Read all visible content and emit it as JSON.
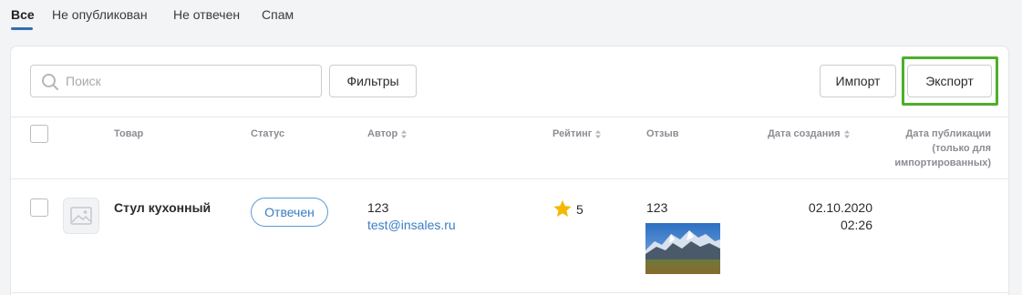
{
  "tabs": [
    {
      "label": "Все",
      "active": true
    },
    {
      "label": "Не опубликован",
      "active": false
    },
    {
      "label": "Не отвечен",
      "active": false
    },
    {
      "label": "Спам",
      "active": false
    }
  ],
  "toolbar": {
    "search_placeholder": "Поиск",
    "search_value": "",
    "filters_label": "Фильтры",
    "import_label": "Импорт",
    "export_label": "Экспорт"
  },
  "columns": {
    "product": "Товар",
    "status": "Статус",
    "author": "Автор",
    "rating": "Рейтинг",
    "review": "Отзыв",
    "created": "Дата создания",
    "published_line1": "Дата публикации",
    "published_line2": "(только для",
    "published_line3": "импортированных)"
  },
  "rows": [
    {
      "product": "Стул кухонный",
      "status": "Отвечен",
      "author_name": "123",
      "author_email": "test@insales.ru",
      "rating": "5",
      "review_text": "123",
      "created_date": "02.10.2020",
      "created_time": "02:26",
      "published": ""
    }
  ],
  "colors": {
    "accent": "#2f6fb5",
    "link": "#3a7cc4",
    "highlight": "#4caf2b",
    "star": "#f5b800"
  },
  "icons": {
    "search": "search-icon",
    "sort": "sort-icon",
    "star": "star-icon",
    "image_placeholder": "image-placeholder-icon"
  }
}
